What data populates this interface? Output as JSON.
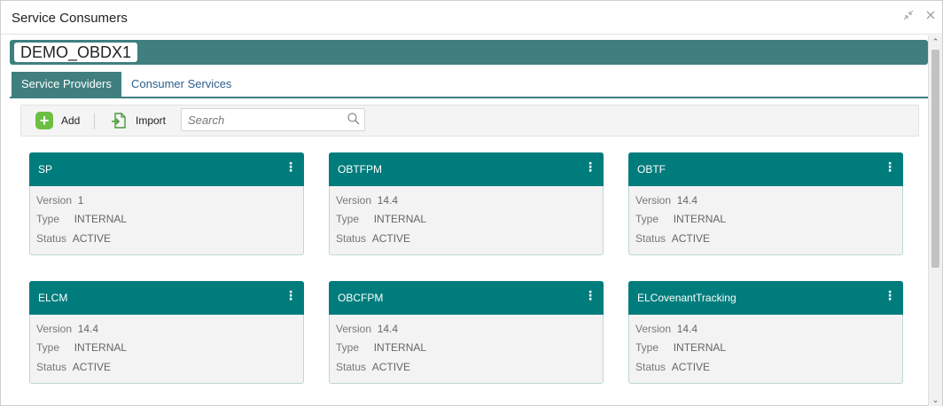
{
  "window": {
    "title": "Service Consumers",
    "minimize_icon": "collapse-arrows-icon",
    "close_icon": "close-icon"
  },
  "app": {
    "name": "DEMO_OBDX1"
  },
  "tabs": [
    {
      "label": "Service Providers",
      "active": true
    },
    {
      "label": "Consumer Services",
      "active": false
    }
  ],
  "toolbar": {
    "add_label": "Add",
    "import_label": "Import",
    "search_placeholder": "Search",
    "search_value": ""
  },
  "labels": {
    "version": "Version",
    "type": "Type",
    "status": "Status"
  },
  "cards": [
    {
      "name": "SP",
      "version": "1",
      "type": "INTERNAL",
      "status": "ACTIVE"
    },
    {
      "name": "OBTFPM",
      "version": "14.4",
      "type": "INTERNAL",
      "status": "ACTIVE"
    },
    {
      "name": "OBTF",
      "version": "14.4",
      "type": "INTERNAL",
      "status": "ACTIVE"
    },
    {
      "name": "ELCM",
      "version": "14.4",
      "type": "INTERNAL",
      "status": "ACTIVE"
    },
    {
      "name": "OBCFPM",
      "version": "14.4",
      "type": "INTERNAL",
      "status": "ACTIVE"
    },
    {
      "name": "ELCovenantTracking",
      "version": "14.4",
      "type": "INTERNAL",
      "status": "ACTIVE"
    }
  ],
  "colors": {
    "accent": "#3f7f7f",
    "card_header": "#007c7c",
    "add_green": "#6cbf42",
    "link": "#2c5f8a"
  }
}
